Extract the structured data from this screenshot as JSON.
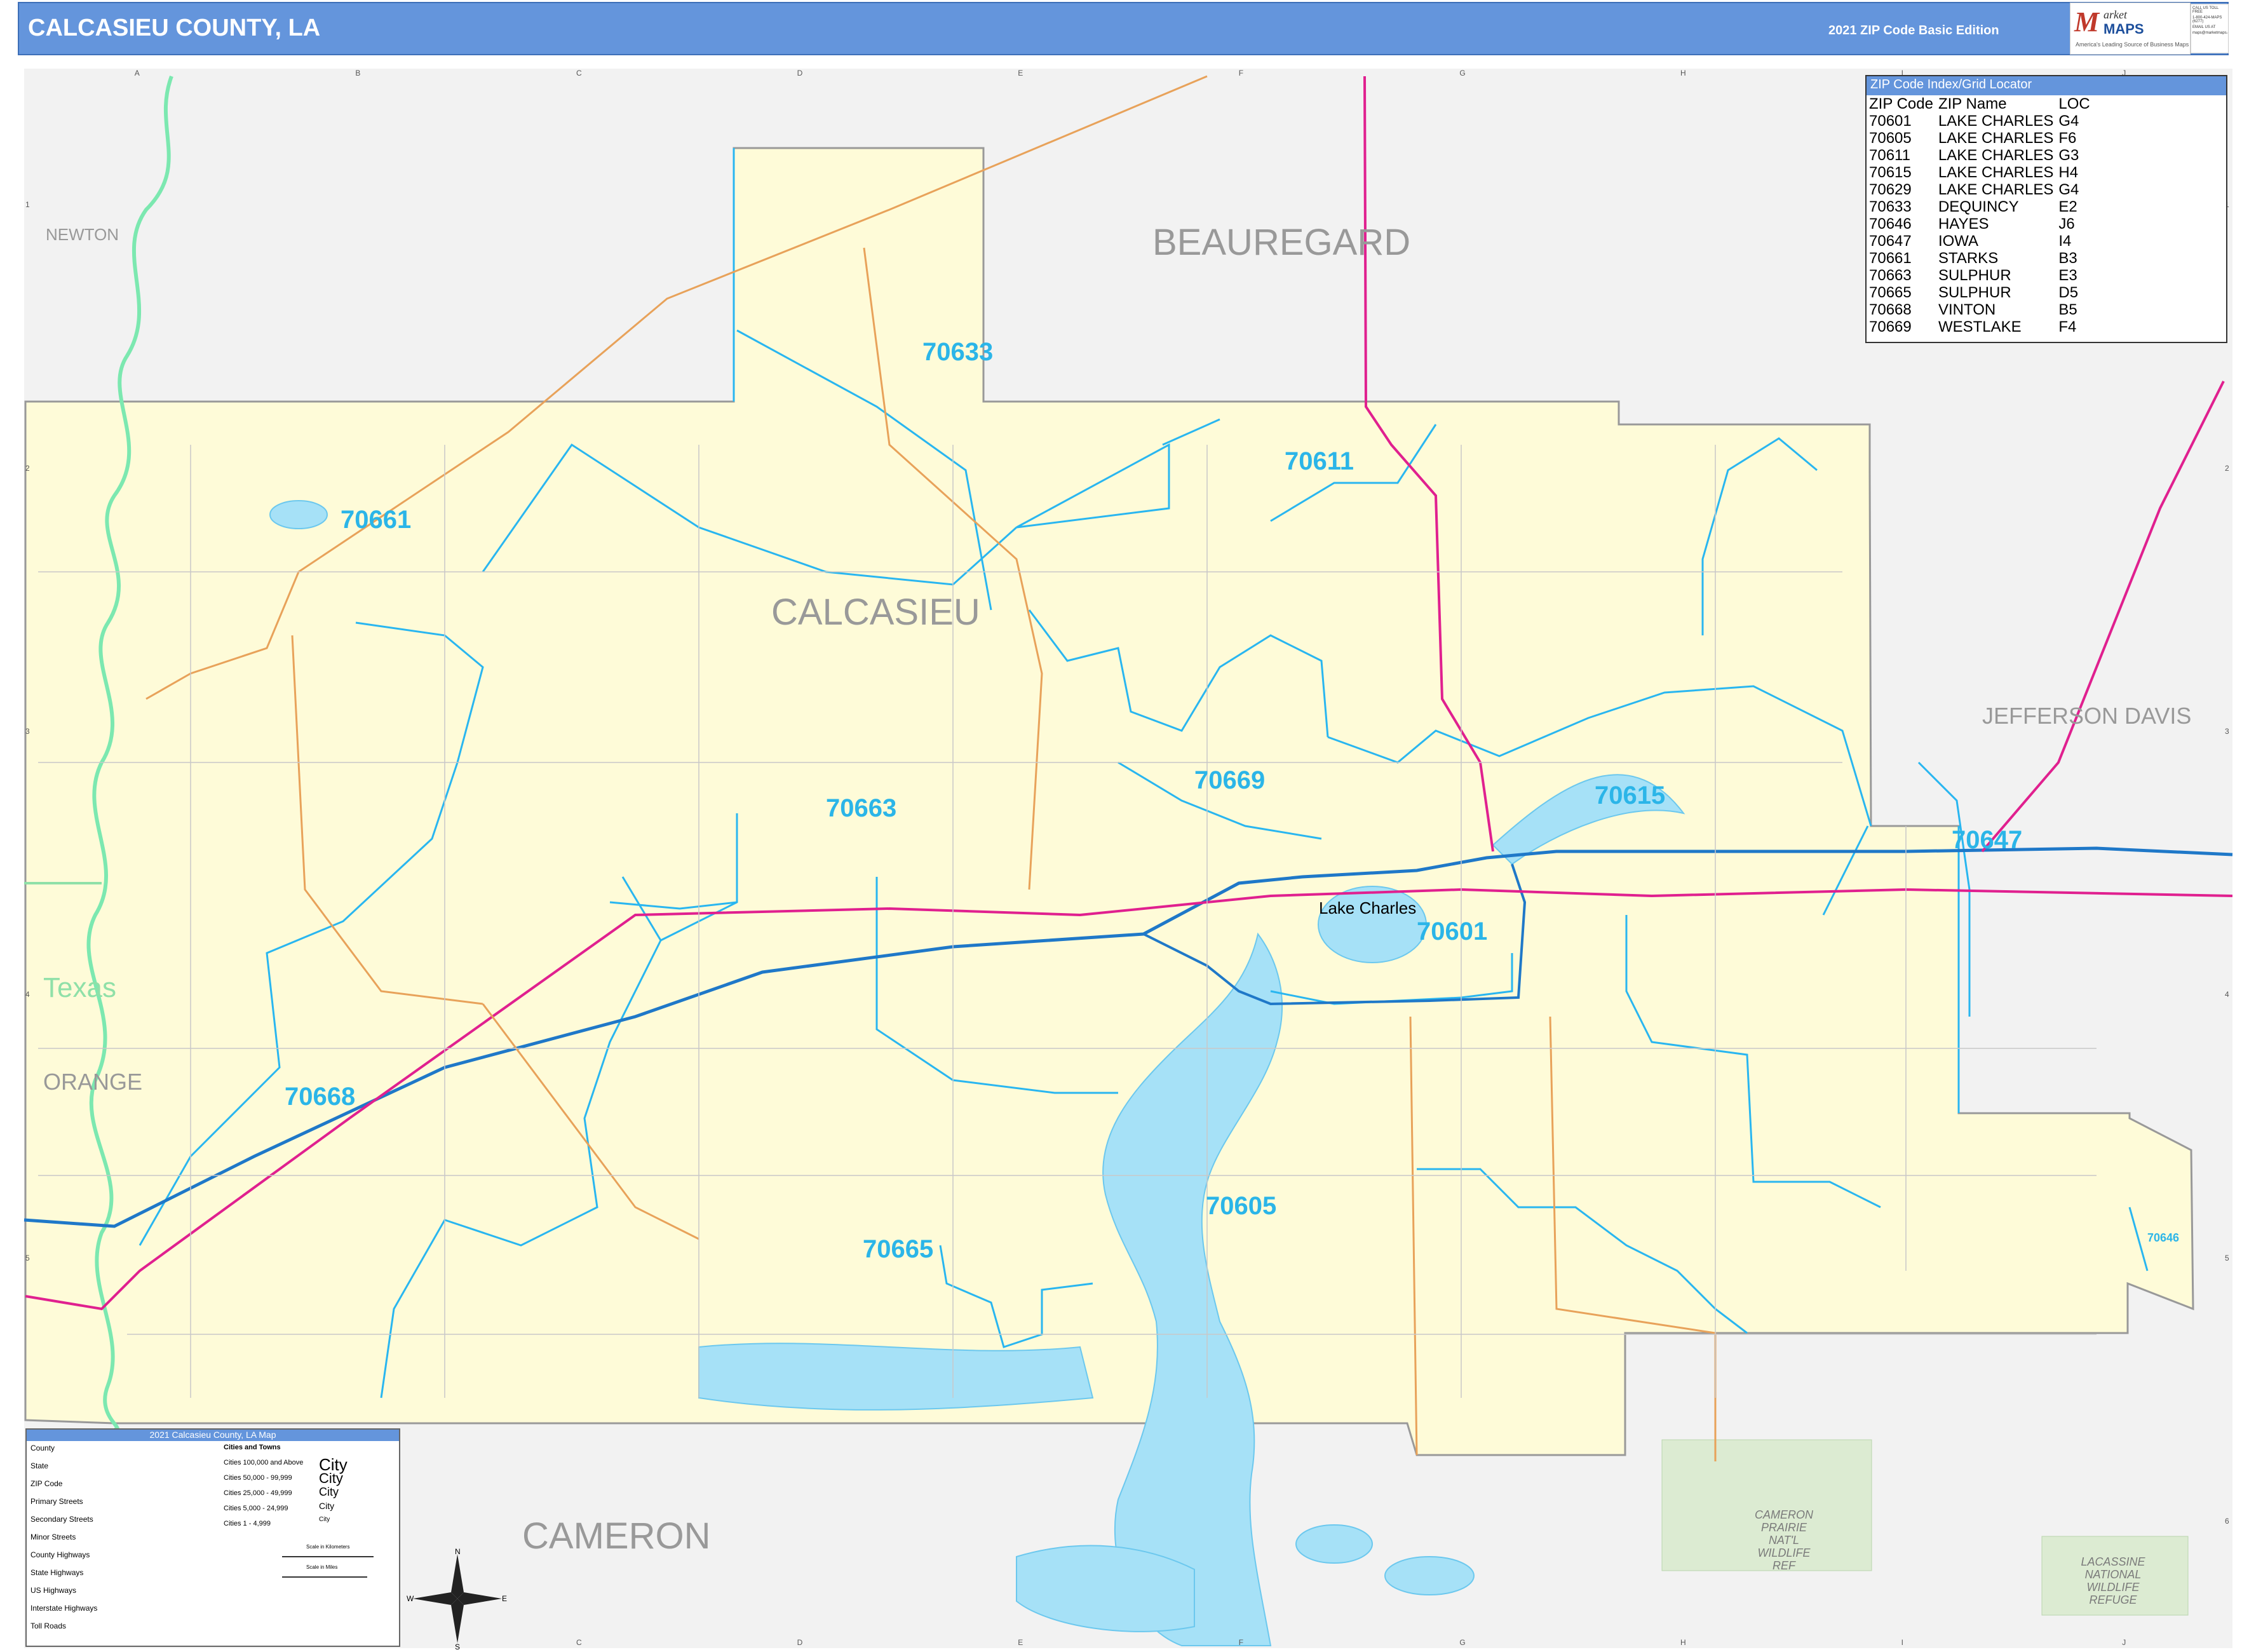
{
  "header": {
    "title": "CALCASIEU COUNTY, LA",
    "edition": "2021 ZIP Code Basic Edition",
    "brand_word1": "arket",
    "brand_word2": "MAPS",
    "brand_tag": "America's Leading Source of Business Maps",
    "contact_line1": "CALL US TOLL FREE",
    "contact_line2": "1-800-424-MAPS (6277)",
    "contact_line3": "EMAIL US AT",
    "contact_line4": "maps@marketmaps.com"
  },
  "grid": {
    "columns": [
      "A",
      "B",
      "C",
      "D",
      "E",
      "F",
      "G",
      "H",
      "I",
      "J"
    ],
    "rows": [
      "1",
      "2",
      "3",
      "4",
      "5",
      "6"
    ]
  },
  "zip_index": {
    "title": "ZIP Code Index/Grid Locator",
    "headers": [
      "ZIP Code",
      "ZIP Name",
      "LOC"
    ],
    "rows": [
      [
        "70601",
        "LAKE CHARLES",
        "G4"
      ],
      [
        "70605",
        "LAKE CHARLES",
        "F6"
      ],
      [
        "70611",
        "LAKE CHARLES",
        "G3"
      ],
      [
        "70615",
        "LAKE CHARLES",
        "H4"
      ],
      [
        "70629",
        "LAKE CHARLES",
        "G4"
      ],
      [
        "70633",
        "DEQUINCY",
        "E2"
      ],
      [
        "70646",
        "HAYES",
        "J6"
      ],
      [
        "70647",
        "IOWA",
        "I4"
      ],
      [
        "70661",
        "STARKS",
        "B3"
      ],
      [
        "70663",
        "SULPHUR",
        "E3"
      ],
      [
        "70665",
        "SULPHUR",
        "D5"
      ],
      [
        "70668",
        "VINTON",
        "B5"
      ],
      [
        "70669",
        "WESTLAKE",
        "F4"
      ]
    ]
  },
  "labels": {
    "counties": {
      "calcasieu": "CALCASIEU",
      "beauregard": "BEAUREGARD",
      "jefferson_davis": "JEFFERSON DAVIS",
      "cameron": "CAMERON",
      "newton": "NEWTON",
      "orange": "ORANGE"
    },
    "state": "Texas",
    "zips": {
      "z70633": "70633",
      "z70611": "70611",
      "z70661": "70661",
      "z70669": "70669",
      "z70615": "70615",
      "z70663": "70663",
      "z70647": "70647",
      "z70601": "70601",
      "z70668": "70668",
      "z70605": "70605",
      "z70665": "70665",
      "z70646": "70646"
    },
    "city": "Lake Charles",
    "refuge1": "CAMERON PRAIRIE NAT'L WILDLIFE REF",
    "refuge2": "LACASSINE NATIONAL WILDLIFE REFUGE"
  },
  "legend": {
    "title": "2021 Calcasieu County, LA Map",
    "items": [
      "County",
      "State",
      "ZIP Code",
      "Primary Streets",
      "Secondary Streets",
      "Minor Streets",
      "County Highways",
      "State Highways",
      "US Highways",
      "Interstate Highways",
      "Toll Roads"
    ],
    "cities_title": "Cities and Towns",
    "cities": [
      "Cities 100,000 and Above",
      "Cities 50,000 - 99,999",
      "Cities 25,000 - 49,999",
      "Cities 5,000 - 24,999",
      "Cities 1 - 4,999"
    ],
    "city_samples": [
      "City",
      "City",
      "City",
      "City",
      "City"
    ],
    "scale_km": "Scale in Kilometers",
    "scale_mi": "Scale in Miles"
  },
  "colors": {
    "header": "#6495dc",
    "county_fill": "#fefbd8",
    "outside_fill": "#f2f2f2",
    "zip_line": "#29b6f0",
    "water": "#a6e1f7",
    "interstate": "#1f78c8",
    "us_highway": "#e0208f",
    "state_highway": "#e8a25a",
    "refuge": "#dcebd2"
  }
}
